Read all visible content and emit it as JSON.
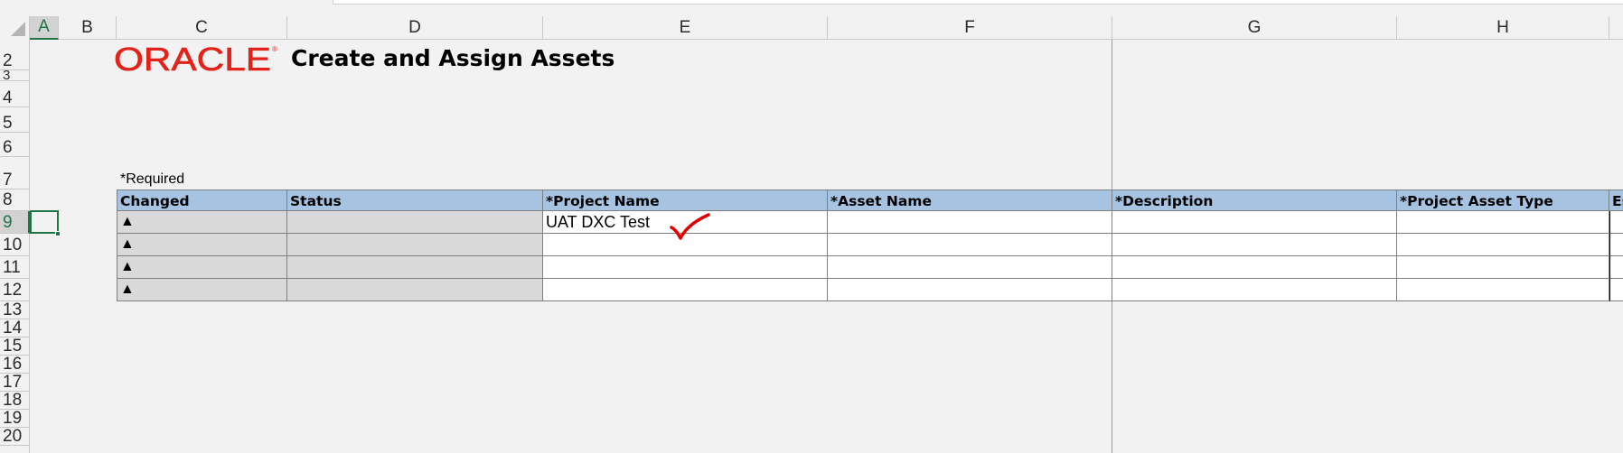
{
  "columns": [
    "A",
    "B",
    "C",
    "D",
    "E",
    "F",
    "G",
    "H"
  ],
  "rows": [
    "2",
    "3",
    "4",
    "5",
    "6",
    "7",
    "8",
    "9",
    "10",
    "11",
    "12",
    "13",
    "14",
    "15",
    "16",
    "17",
    "18",
    "19",
    "20"
  ],
  "active_cell": {
    "column": "A",
    "row": "9"
  },
  "logo_text": "ORACLE",
  "sheet_title": "Create and Assign Assets",
  "required_note": "*Required",
  "table": {
    "headers": [
      "Changed",
      "Status",
      "*Project Name",
      "*Asset Name",
      "*Description",
      "*Project Asset Type",
      "Es"
    ],
    "rows": [
      {
        "changed": "▲",
        "status": "",
        "project_name": "UAT DXC Test",
        "asset_name": "",
        "description": "",
        "asset_type": ""
      },
      {
        "changed": "▲",
        "status": "",
        "project_name": "",
        "asset_name": "",
        "description": "",
        "asset_type": ""
      },
      {
        "changed": "▲",
        "status": "",
        "project_name": "",
        "asset_name": "",
        "description": "",
        "asset_type": ""
      },
      {
        "changed": "▲",
        "status": "",
        "project_name": "",
        "asset_name": "",
        "description": "",
        "asset_type": ""
      }
    ]
  },
  "colors": {
    "header_fill": "#a6c4e2",
    "readonly_fill": "#d9d9d9",
    "logo_red": "#e2231a",
    "selection_green": "#217346",
    "check_red": "#e00000"
  }
}
